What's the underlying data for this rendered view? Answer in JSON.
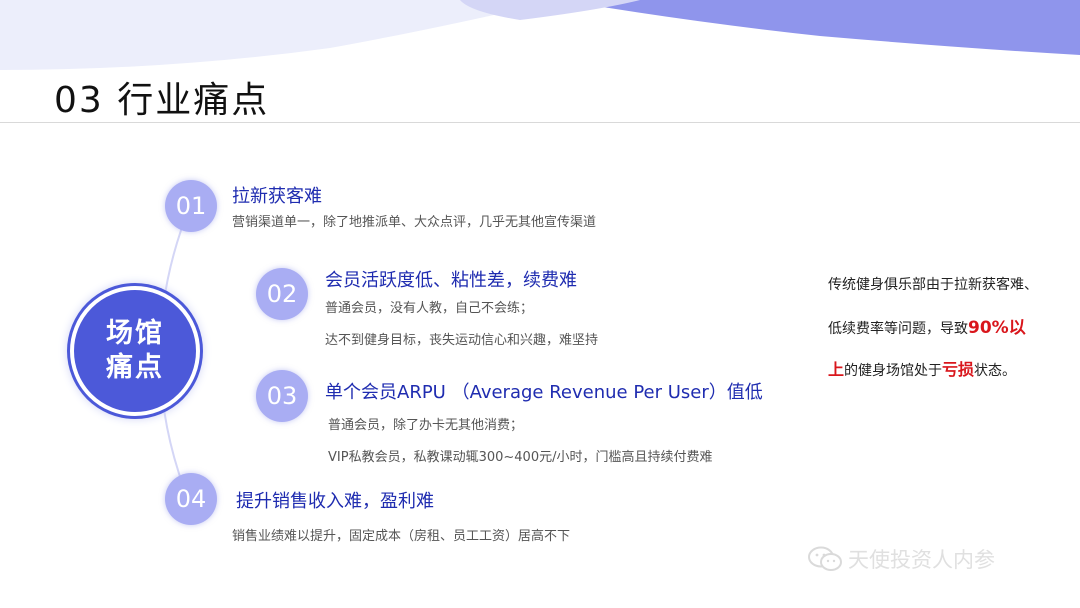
{
  "slide": {
    "title": "03 行业痛点",
    "hub": {
      "line1": "场馆",
      "line2": "痛点"
    }
  },
  "items": [
    {
      "num": "01",
      "heading": "拉新获客难",
      "desc": [
        "营销渠道单一，除了地推派单、大众点评，几乎无其他宣传渠道"
      ]
    },
    {
      "num": "02",
      "heading": "会员活跃度低、粘性差，续费难",
      "desc": [
        "普通会员，没有人教，自己不会练；",
        "达不到健身目标，丧失运动信心和兴趣，难坚持"
      ]
    },
    {
      "num": "03",
      "heading": "单个会员ARPU （Average Revenue Per User）值低",
      "desc": [
        "普通会员，除了办卡无其他消费；",
        "VIP私教会员，私教课动辄300~400元/小时，门槛高且持续付费难"
      ]
    },
    {
      "num": "04",
      "heading": "提升销售收入难，盈利难",
      "desc": [
        "销售业绩难以提升，固定成本（房租、员工工资）居高不下"
      ]
    }
  ],
  "side_note": {
    "line1": "传统健身俱乐部由于拉新获客难、",
    "line2_a": "低续费率等问题，导致",
    "line2_b": "90%以",
    "line3_a": "上",
    "line3_b": "的健身场馆处于",
    "line3_c": "亏损",
    "line3_d": "状态。"
  },
  "watermark": {
    "text": "天使投资人内参",
    "icon": "wechat-icon"
  },
  "colors": {
    "accent": "#4c59d9",
    "badge": "#a9adf3",
    "heading": "#1f2cb0",
    "highlight": "#d9161c"
  }
}
